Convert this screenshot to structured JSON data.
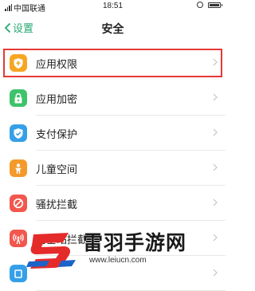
{
  "status_bar": {
    "carrier": "中国联通",
    "time": "18:51"
  },
  "nav": {
    "back_label": "设置",
    "title": "安全"
  },
  "items": [
    {
      "label": "应用权限",
      "icon": "shield-icon",
      "color": "#f6a623",
      "highlighted": true
    },
    {
      "label": "应用加密",
      "icon": "lock-icon",
      "color": "#3ec36a"
    },
    {
      "label": "支付保护",
      "icon": "shield-check-icon",
      "color": "#35a0e8"
    },
    {
      "label": "儿童空间",
      "icon": "child-icon",
      "color": "#f39a2a"
    },
    {
      "label": "骚扰拦截",
      "icon": "block-icon",
      "color": "#f2574e"
    },
    {
      "label": "伪基站拦截",
      "icon": "antenna-icon",
      "color": "#f2574e"
    },
    {
      "label": "",
      "icon": "partial-icon",
      "color": "#35a0e8"
    }
  ],
  "watermark": {
    "title": "雷羽手游网",
    "url": "www.leiucn.com"
  },
  "colors": {
    "accent": "#28a876",
    "highlight_border": "#e53935"
  }
}
